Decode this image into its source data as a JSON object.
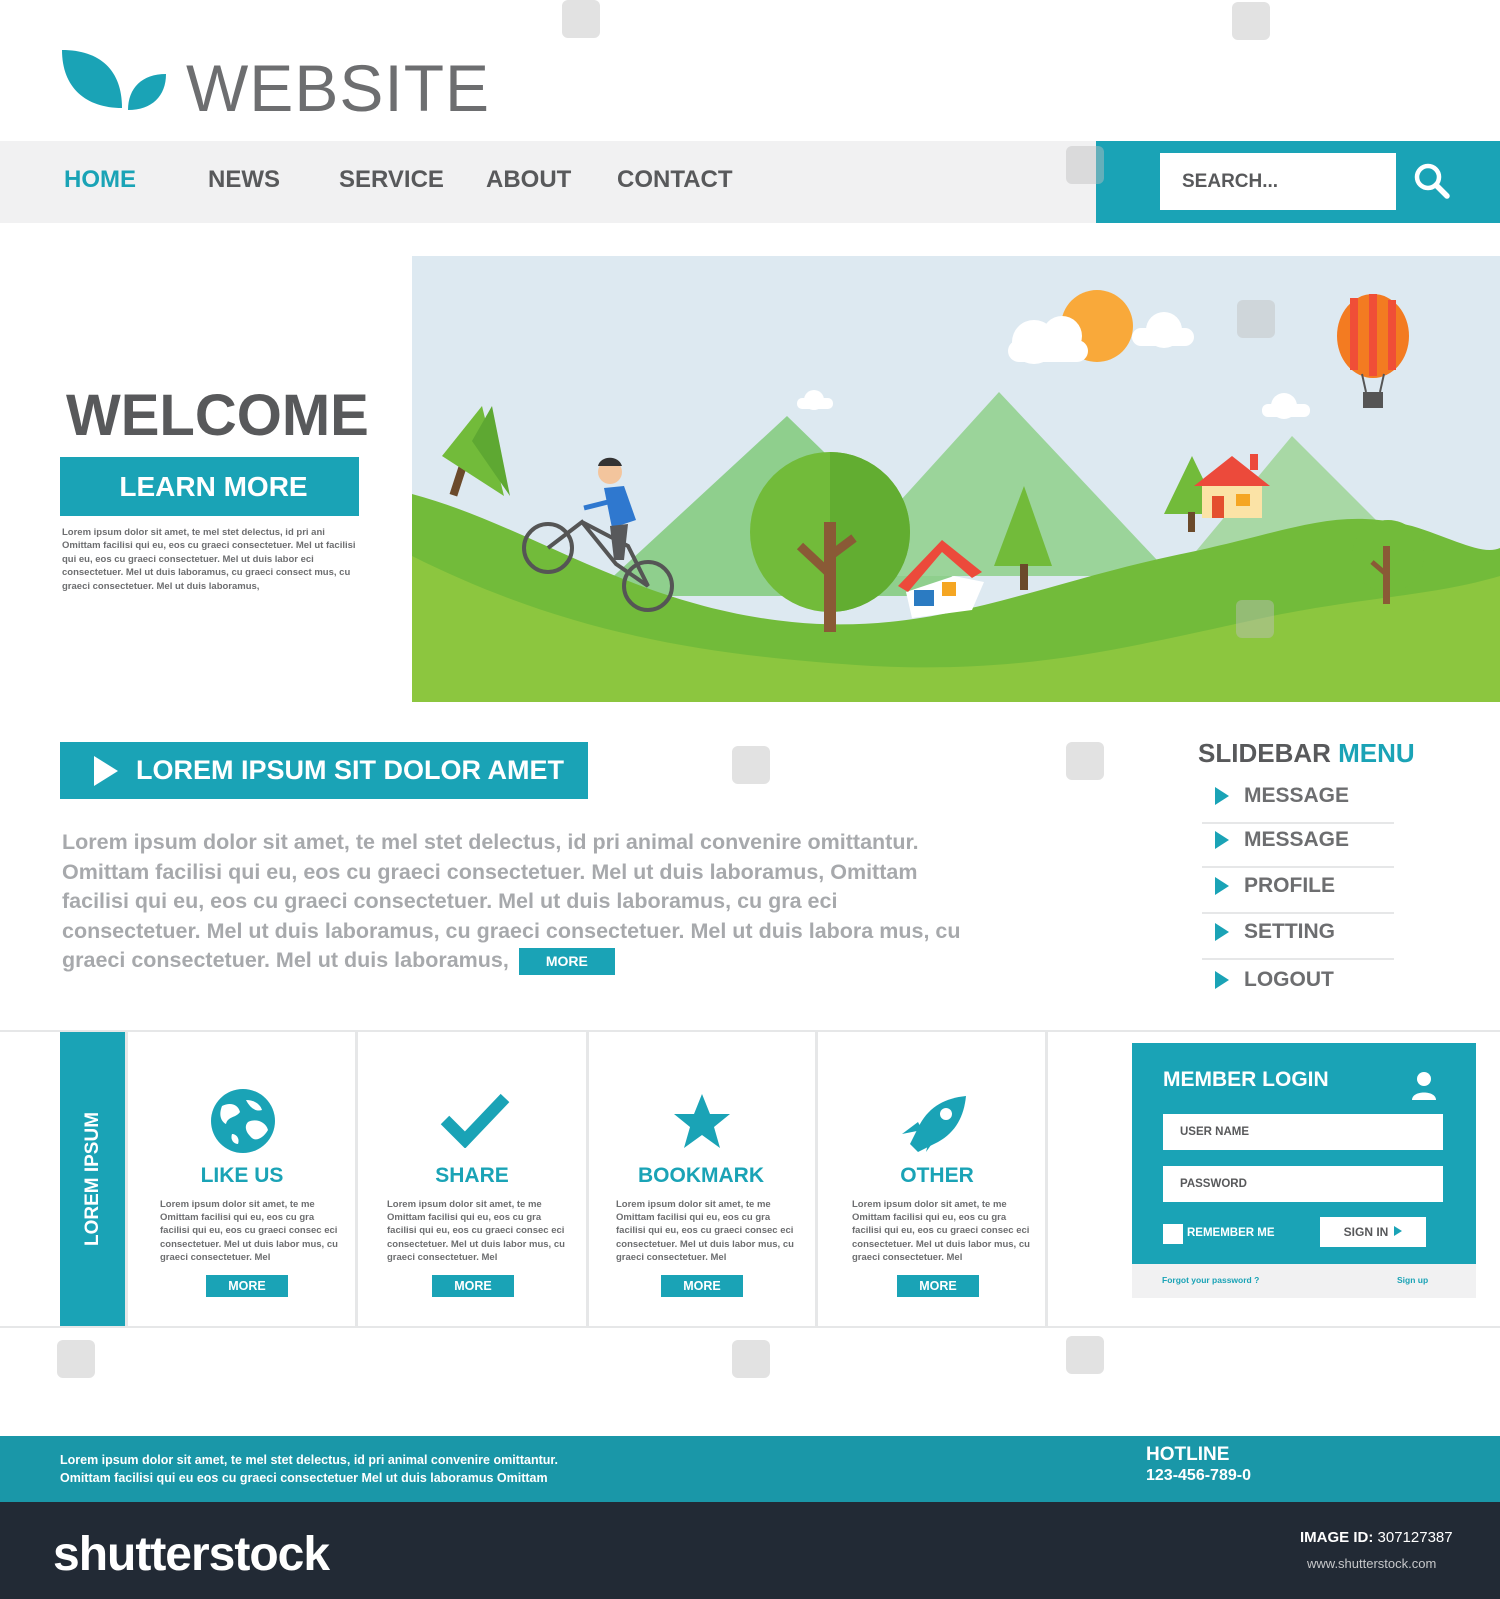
{
  "brand": {
    "name": "WEBSITE",
    "icon": "leaf-icon"
  },
  "colors": {
    "accent": "#1aa3b6",
    "text_dark": "#58595b",
    "text_light": "#a7a9ac",
    "nav_bg": "#f1f1f2",
    "footer": "#1a97a8",
    "stock_bar": "#222a35"
  },
  "nav": {
    "items": [
      "HOME",
      "NEWS",
      "SERVICE",
      "ABOUT",
      "CONTACT"
    ],
    "active": "HOME"
  },
  "search": {
    "placeholder": "SEARCH...",
    "icon": "search-icon"
  },
  "hero": {
    "heading": "WELCOME",
    "button": "LEARN MORE",
    "text": "Lorem ipsum dolor sit amet, te mel stet delectus, id pri ani Omittam facilisi qui eu, eos cu graeci consectetuer. Mel ut facilisi qui eu, eos cu graeci consectetuer. Mel ut duis labor eci consectetuer. Mel ut duis laboramus, cu graeci consect mus, cu graeci consectetuer. Mel ut duis laboramus,"
  },
  "section": {
    "title": "LOREM IPSUM SIT DOLOR AMET",
    "body": "Lorem ipsum dolor sit amet, te mel stet delectus, id pri animal convenire omittantur. Omittam facilisi qui eu, eos cu graeci consectetuer. Mel ut duis laboramus, Omittam facilisi qui eu, eos cu graeci consectetuer. Mel ut duis laboramus,   cu gra eci consectetuer. Mel ut duis laboramus,   cu graeci consectetuer. Mel ut duis labora mus,  cu graeci consectetuer. Mel ut duis laboramus,",
    "more": "MORE"
  },
  "sidebar": {
    "title_plain": "SLIDEBAR",
    "title_accent": "MENU",
    "items": [
      "MESSAGE",
      "MESSAGE",
      "PROFILE",
      "SETTING",
      "LOGOUT"
    ]
  },
  "features": {
    "tab_label": "LOREM IPSUM",
    "cards": [
      {
        "title": "LIKE US",
        "icon": "globe-icon",
        "more": "MORE",
        "text": "Lorem ipsum dolor sit amet, te me Omittam facilisi qui eu, eos cu gra facilisi qui eu, eos cu graeci consec eci consectetuer. Mel ut duis labor mus,  cu graeci consectetuer. Mel"
      },
      {
        "title": "SHARE",
        "icon": "checkmark-icon",
        "more": "MORE",
        "text": "Lorem ipsum dolor sit amet, te me Omittam facilisi qui eu, eos cu gra facilisi qui eu, eos cu graeci consec eci consectetuer. Mel ut duis labor mus,  cu graeci consectetuer. Mel"
      },
      {
        "title": "BOOKMARK",
        "icon": "star-icon",
        "more": "MORE",
        "text": "Lorem ipsum dolor sit amet, te me Omittam facilisi qui eu, eos cu gra facilisi qui eu, eos cu graeci consec eci consectetuer. Mel ut duis labor mus,  cu graeci consectetuer. Mel"
      },
      {
        "title": "OTHER",
        "icon": "rocket-icon",
        "more": "MORE",
        "text": "Lorem ipsum dolor sit amet, te me Omittam facilisi qui eu, eos cu gra facilisi qui eu, eos cu graeci consec eci consectetuer. Mel ut duis labor mus,  cu graeci consectetuer. Mel"
      }
    ]
  },
  "login": {
    "title": "MEMBER LOGIN",
    "icon": "user-icon",
    "username_placeholder": "USER NAME",
    "password_placeholder": "PASSWORD",
    "remember": "REMEMBER ME",
    "signin": "SIGN IN",
    "forgot": "Forgot your password ?",
    "signup": "Sign up"
  },
  "footer": {
    "line1": "Lorem ipsum dolor sit amet, te mel stet delectus, id pri animal convenire omittantur.",
    "line2": "Omittam facilisi qui eu  eos cu graeci consectetuer  Mel ut duis laboramus  Omittam",
    "hotline_label": "HOTLINE",
    "hotline_number": "123-456-789-0"
  },
  "stock": {
    "logo": "shutterstock",
    "image_id_label": "IMAGE ID:",
    "image_id": "307127387",
    "url": "www.shutterstock.com"
  }
}
